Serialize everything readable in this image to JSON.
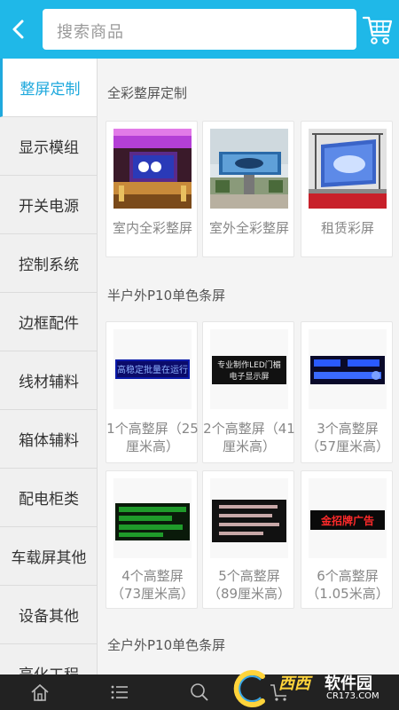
{
  "header": {
    "search_placeholder": "搜索商品"
  },
  "sidebar": {
    "items": [
      {
        "label": "整屏定制",
        "active": true
      },
      {
        "label": "显示模组"
      },
      {
        "label": "开关电源"
      },
      {
        "label": "控制系统"
      },
      {
        "label": "边框配件"
      },
      {
        "label": "线材辅料"
      },
      {
        "label": "箱体辅料"
      },
      {
        "label": "配电柜类"
      },
      {
        "label": "车载屏其他"
      },
      {
        "label": "设备其他"
      },
      {
        "label": "亮化工程"
      }
    ]
  },
  "sections": [
    {
      "title": "全彩整屏定制",
      "items": [
        {
          "label": "室内全彩整屏"
        },
        {
          "label": "室外全彩整屏"
        },
        {
          "label": "租赁彩屏"
        }
      ]
    },
    {
      "title": "半户外P10单色条屏",
      "items": [
        {
          "line1": "1个高整屏（25",
          "line2": "厘米高）",
          "sign_text": "高稳定批量在运行"
        },
        {
          "line1": "2个高整屏（41",
          "line2": "厘米高）",
          "sign_line1": "专业制作LED门楣",
          "sign_line2": "电子显示屏"
        },
        {
          "line1": "3个高整屏",
          "line2": "（57厘米高）"
        },
        {
          "line1": "4个高整屏",
          "line2": "（73厘米高）"
        },
        {
          "line1": "5个高整屏",
          "line2": "（89厘米高）"
        },
        {
          "line1": "6个高整屏",
          "line2": "（1.05米高）",
          "sign_text": "金招牌广告"
        }
      ]
    },
    {
      "title": "全户外P10单色条屏"
    }
  ],
  "watermark": {
    "brand": "西西",
    "name": "软件园",
    "url": "CR173.COM"
  },
  "colors": {
    "accent": "#1fb8e8",
    "active_text": "#1fa9dd",
    "nav_bg": "#222222"
  }
}
